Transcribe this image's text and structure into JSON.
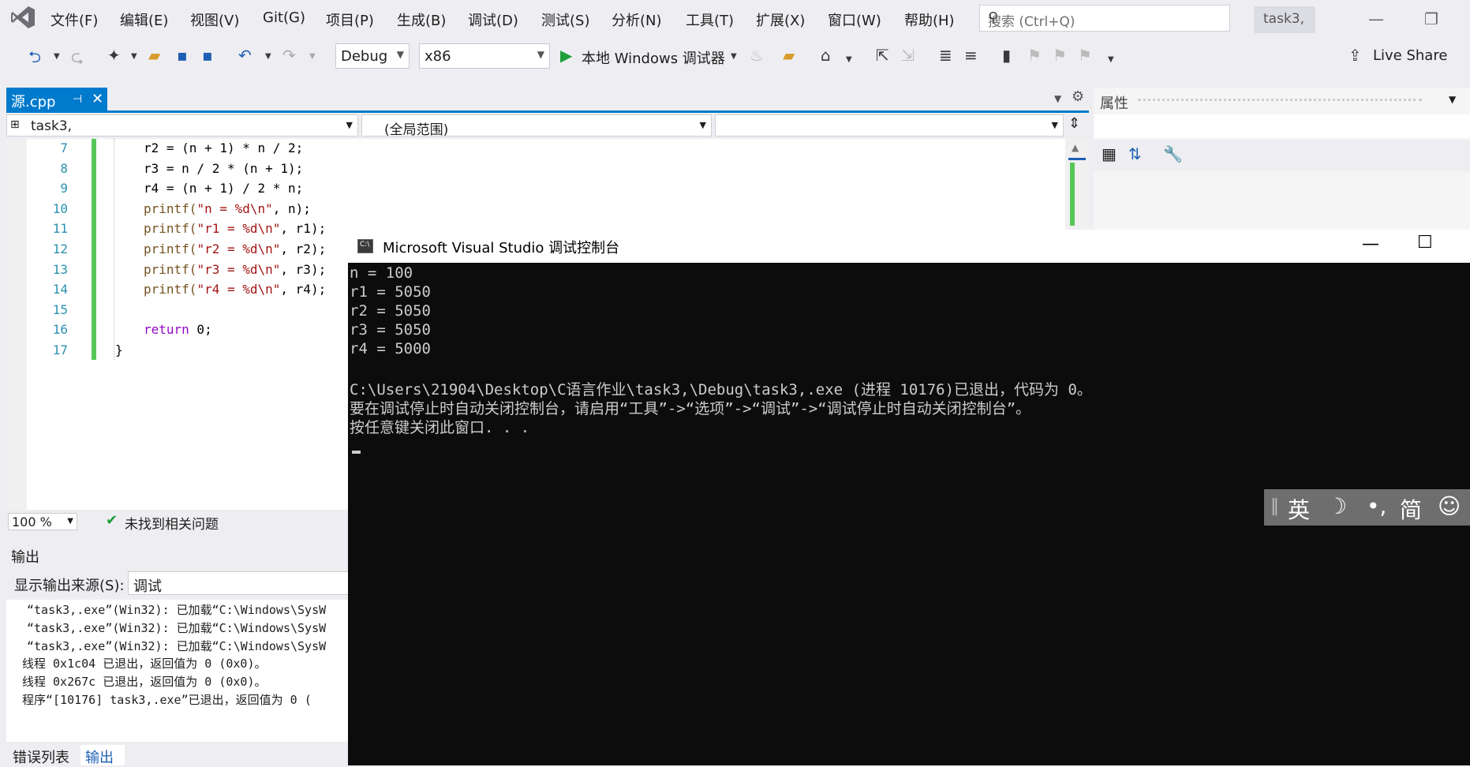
{
  "menubar": {
    "items": [
      "文件(F)",
      "编辑(E)",
      "视图(V)",
      "Git(G)",
      "项目(P)",
      "生成(B)",
      "调试(D)",
      "测试(S)",
      "分析(N)",
      "工具(T)",
      "扩展(X)",
      "窗口(W)",
      "帮助(H)"
    ],
    "search_placeholder": "搜索 (Ctrl+Q)",
    "solution_name": "task3,"
  },
  "toolbar": {
    "config": "Debug",
    "platform": "x86",
    "debug_target": "本地 Windows 调试器",
    "live_share": "Live Share"
  },
  "document": {
    "tab_name": "源.cpp",
    "nav_project": "task3,",
    "nav_scope": "(全局范围)"
  },
  "editor": {
    "lines": [
      {
        "n": "7",
        "code": "r2 = (n + 1) * n / 2;"
      },
      {
        "n": "8",
        "code": "r3 = n / 2 * (n + 1);"
      },
      {
        "n": "9",
        "code": "r4 = (n + 1) / 2 * n;"
      },
      {
        "n": "10",
        "pre": "printf(",
        "str": "\"n = %d\\n\"",
        "post": ", n);"
      },
      {
        "n": "11",
        "pre": "printf(",
        "str": "\"r1 = %d\\n\"",
        "post": ", r1);"
      },
      {
        "n": "12",
        "pre": "printf(",
        "str": "\"r2 = %d\\n\"",
        "post": ", r2);"
      },
      {
        "n": "13",
        "pre": "printf(",
        "str": "\"r3 = %d\\n\"",
        "post": ", r3);"
      },
      {
        "n": "14",
        "pre": "printf(",
        "str": "\"r4 = %d\\n\"",
        "post": ", r4);"
      },
      {
        "n": "15",
        "code": ""
      },
      {
        "n": "16",
        "kw": "return",
        "post": " 0;"
      },
      {
        "n": "17",
        "code": "}"
      }
    ],
    "zoom": "100 %",
    "status": "未找到相关问题"
  },
  "output": {
    "title": "输出",
    "source_label": "显示输出来源(S):",
    "source_value": "调试",
    "lines": [
      "“task3,.exe”(Win32): 已加载“C:\\Windows\\SysW",
      "“task3,.exe”(Win32): 已加载“C:\\Windows\\SysW",
      "“task3,.exe”(Win32): 已加载“C:\\Windows\\SysW",
      "线程 0x1c04 已退出，返回值为 0 (0x0)。",
      "线程 0x267c 已退出，返回值为 0 (0x0)。",
      "程序“[10176] task3,.exe”已退出，返回值为 0 ("
    ],
    "tabs": [
      "错误列表",
      "输出"
    ]
  },
  "properties": {
    "title": "属性"
  },
  "console": {
    "title": "Microsoft Visual Studio 调试控制台",
    "lines": [
      "n = 100",
      "r1 = 5050",
      "r2 = 5050",
      "r3 = 5050",
      "r4 = 5000",
      "",
      "C:\\Users\\21904\\Desktop\\C语言作业\\task3,\\Debug\\task3,.exe (进程 10176)已退出，代码为 0。",
      "要在调试停止时自动关闭控制台，请启用“工具”->“选项”->“调试”->“调试停止时自动关闭控制台”。",
      "按任意键关闭此窗口. . ."
    ]
  },
  "ime": {
    "lang": "英",
    "moon": "☽",
    "punct": "•,",
    "mode": "简",
    "emoji": "☺"
  }
}
